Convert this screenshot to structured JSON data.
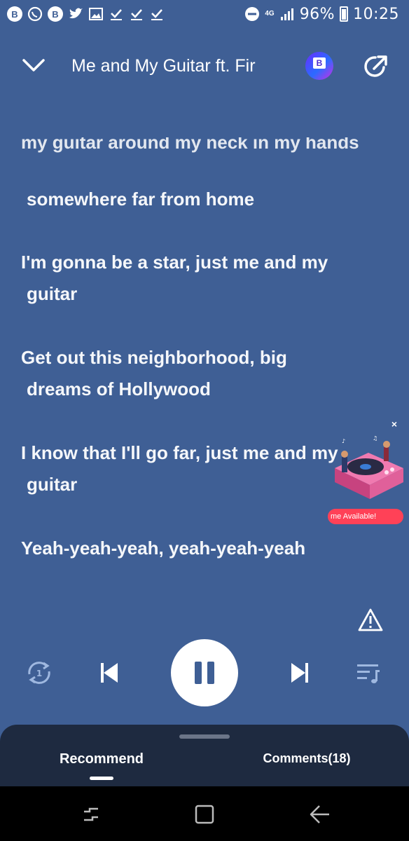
{
  "status_bar": {
    "left_icons": [
      "beetalk-icon",
      "whatsapp-icon",
      "beetalk-icon",
      "twitter-icon",
      "image-icon",
      "check-icon",
      "check-icon",
      "check-icon"
    ],
    "network": "4G",
    "battery": "96%",
    "time": "10:25"
  },
  "header": {
    "title": "Me and My Guitar ft. Fir"
  },
  "lyrics": {
    "faded_line": "my guitar around my neck in my hands",
    "lines": [
      {
        "text": "somewhere far from home",
        "cont": ""
      },
      {
        "text": "I'm gonna be a star, just me and my",
        "cont": "guitar"
      },
      {
        "text": "Get out this neighborhood, big",
        "cont": "dreams of Hollywood"
      },
      {
        "text": "I know that I'll go far, just me and my",
        "cont": "guitar"
      },
      {
        "text": "Yeah-yeah-yeah, yeah-yeah-yeah",
        "cont": ""
      }
    ]
  },
  "promo": {
    "close": "×",
    "badge": "me Available!"
  },
  "controls": {
    "repeat_count": "1"
  },
  "sheet": {
    "tab_recommend": "Recommend",
    "tab_comments": "Comments(18)"
  }
}
